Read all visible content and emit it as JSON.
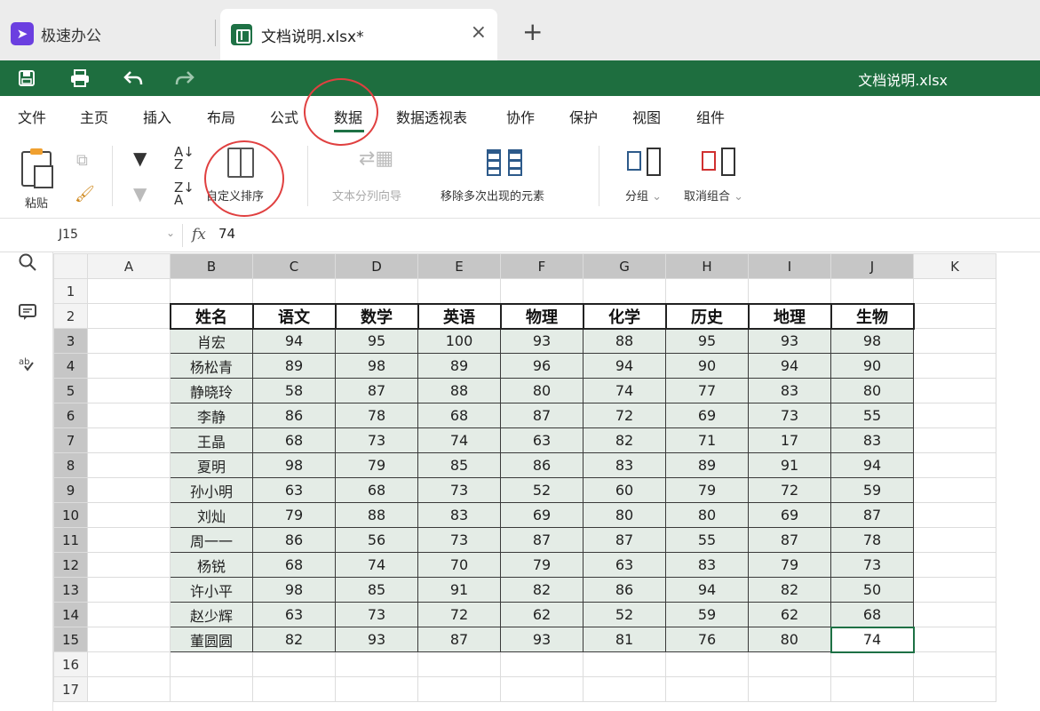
{
  "tabs": {
    "app_name": "极速办公",
    "doc_tab_label": "文档说明.xlsx*",
    "close_glyph": "×",
    "new_tab_glyph": "+"
  },
  "titlebar": {
    "doc_title": "文档说明.xlsx"
  },
  "menu": {
    "items": [
      "文件",
      "主页",
      "插入",
      "布局",
      "公式",
      "数据",
      "数据透视表",
      "协作",
      "保护",
      "视图",
      "组件"
    ],
    "active": "数据"
  },
  "ribbon": {
    "paste": "粘贴",
    "custom_sort": "自定义排序",
    "text_to_columns": "文本分列向导",
    "remove_duplicates": "移除多次出现的元素",
    "group": "分组",
    "ungroup": "取消组合",
    "dropdown_glyph": "⌄"
  },
  "formula_bar": {
    "cell_ref": "J15",
    "fx": "fx",
    "value": "74"
  },
  "sheet": {
    "columns": [
      "A",
      "B",
      "C",
      "D",
      "E",
      "F",
      "G",
      "H",
      "I",
      "J",
      "K"
    ],
    "rows": [
      "1",
      "2",
      "3",
      "4",
      "5",
      "6",
      "7",
      "8",
      "9",
      "10",
      "11",
      "12",
      "13",
      "14",
      "15",
      "16",
      "17"
    ],
    "table_headers": [
      "姓名",
      "语文",
      "数学",
      "英语",
      "物理",
      "化学",
      "历史",
      "地理",
      "生物"
    ],
    "table_rows": [
      [
        "肖宏",
        "94",
        "95",
        "100",
        "93",
        "88",
        "95",
        "93",
        "98"
      ],
      [
        "杨松青",
        "89",
        "98",
        "89",
        "96",
        "94",
        "90",
        "94",
        "90"
      ],
      [
        "静晓玲",
        "58",
        "87",
        "88",
        "80",
        "74",
        "77",
        "83",
        "80"
      ],
      [
        "李静",
        "86",
        "78",
        "68",
        "87",
        "72",
        "69",
        "73",
        "55"
      ],
      [
        "王晶",
        "68",
        "73",
        "74",
        "63",
        "82",
        "71",
        "17",
        "83"
      ],
      [
        "夏明",
        "98",
        "79",
        "85",
        "86",
        "83",
        "89",
        "91",
        "94"
      ],
      [
        "孙小明",
        "63",
        "68",
        "73",
        "52",
        "60",
        "79",
        "72",
        "59"
      ],
      [
        "刘灿",
        "79",
        "88",
        "83",
        "69",
        "80",
        "80",
        "69",
        "87"
      ],
      [
        "周一一",
        "86",
        "56",
        "73",
        "87",
        "87",
        "55",
        "87",
        "78"
      ],
      [
        "杨锐",
        "68",
        "74",
        "70",
        "79",
        "63",
        "83",
        "79",
        "73"
      ],
      [
        "许小平",
        "98",
        "85",
        "91",
        "82",
        "86",
        "94",
        "82",
        "50"
      ],
      [
        "赵少辉",
        "63",
        "73",
        "72",
        "62",
        "52",
        "59",
        "62",
        "68"
      ],
      [
        "董圆圆",
        "82",
        "93",
        "87",
        "93",
        "81",
        "76",
        "80",
        "74"
      ]
    ]
  },
  "colors": {
    "brand_green": "#1e6e3f",
    "highlight_circle": "#e04040",
    "selection_fill": "#e4ece6"
  }
}
